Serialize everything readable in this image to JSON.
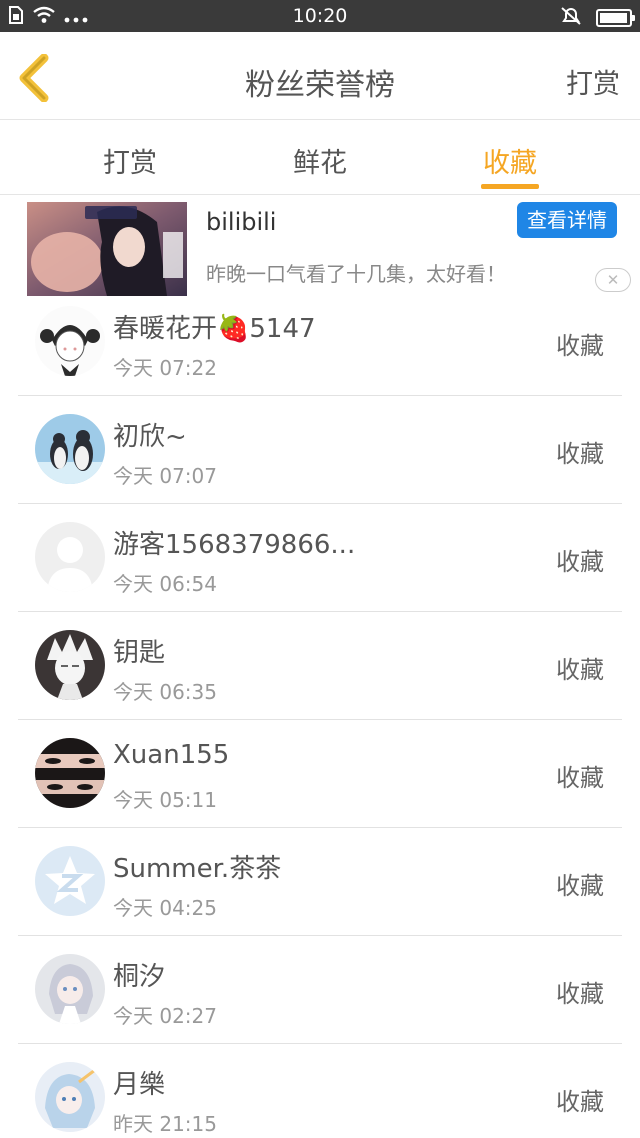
{
  "status_bar": {
    "time": "10:20",
    "battery_level": 0.95
  },
  "header": {
    "title": "粉丝荣誉榜",
    "right_button": "打赏"
  },
  "tabs": [
    {
      "label": "打赏"
    },
    {
      "label": "鲜花"
    },
    {
      "label": "收藏",
      "active": true
    }
  ],
  "ad": {
    "brand": "bilibili",
    "description": "昨晚一口气看了十几集，太好看！",
    "button": "查看详情",
    "close": "✕"
  },
  "fans": [
    {
      "name": "春暖花开🍓5147",
      "time": "今天 07:22",
      "action": "收藏",
      "avatar": "girl-sketch-avatar"
    },
    {
      "name": "初欣~",
      "time": "今天 07:07",
      "action": "收藏",
      "avatar": "penguin-avatar"
    },
    {
      "name": "游客1568379866...",
      "time": "今天 06:54",
      "action": "收藏",
      "avatar": "default-user-avatar"
    },
    {
      "name": "钥匙",
      "time": "今天 06:35",
      "action": "收藏",
      "avatar": "anime-boy-avatar"
    },
    {
      "name": "Xuan155",
      "time": "今天 05:11",
      "action": "收藏",
      "avatar": "eyes-avatar"
    },
    {
      "name": "Summer.茶茶",
      "time": "今天 04:25",
      "action": "收藏",
      "avatar": "star-logo-avatar"
    },
    {
      "name": "桐汐",
      "time": "今天 02:27",
      "action": "收藏",
      "avatar": "anime-girl-avatar"
    },
    {
      "name": "月樂",
      "time": "昨天 21:15",
      "action": "收藏",
      "avatar": "anime-girl-blue-avatar"
    }
  ],
  "colors": {
    "accent": "#f5a623",
    "ad_button": "#1f86e6",
    "status_bar": "#3a3a3a"
  }
}
